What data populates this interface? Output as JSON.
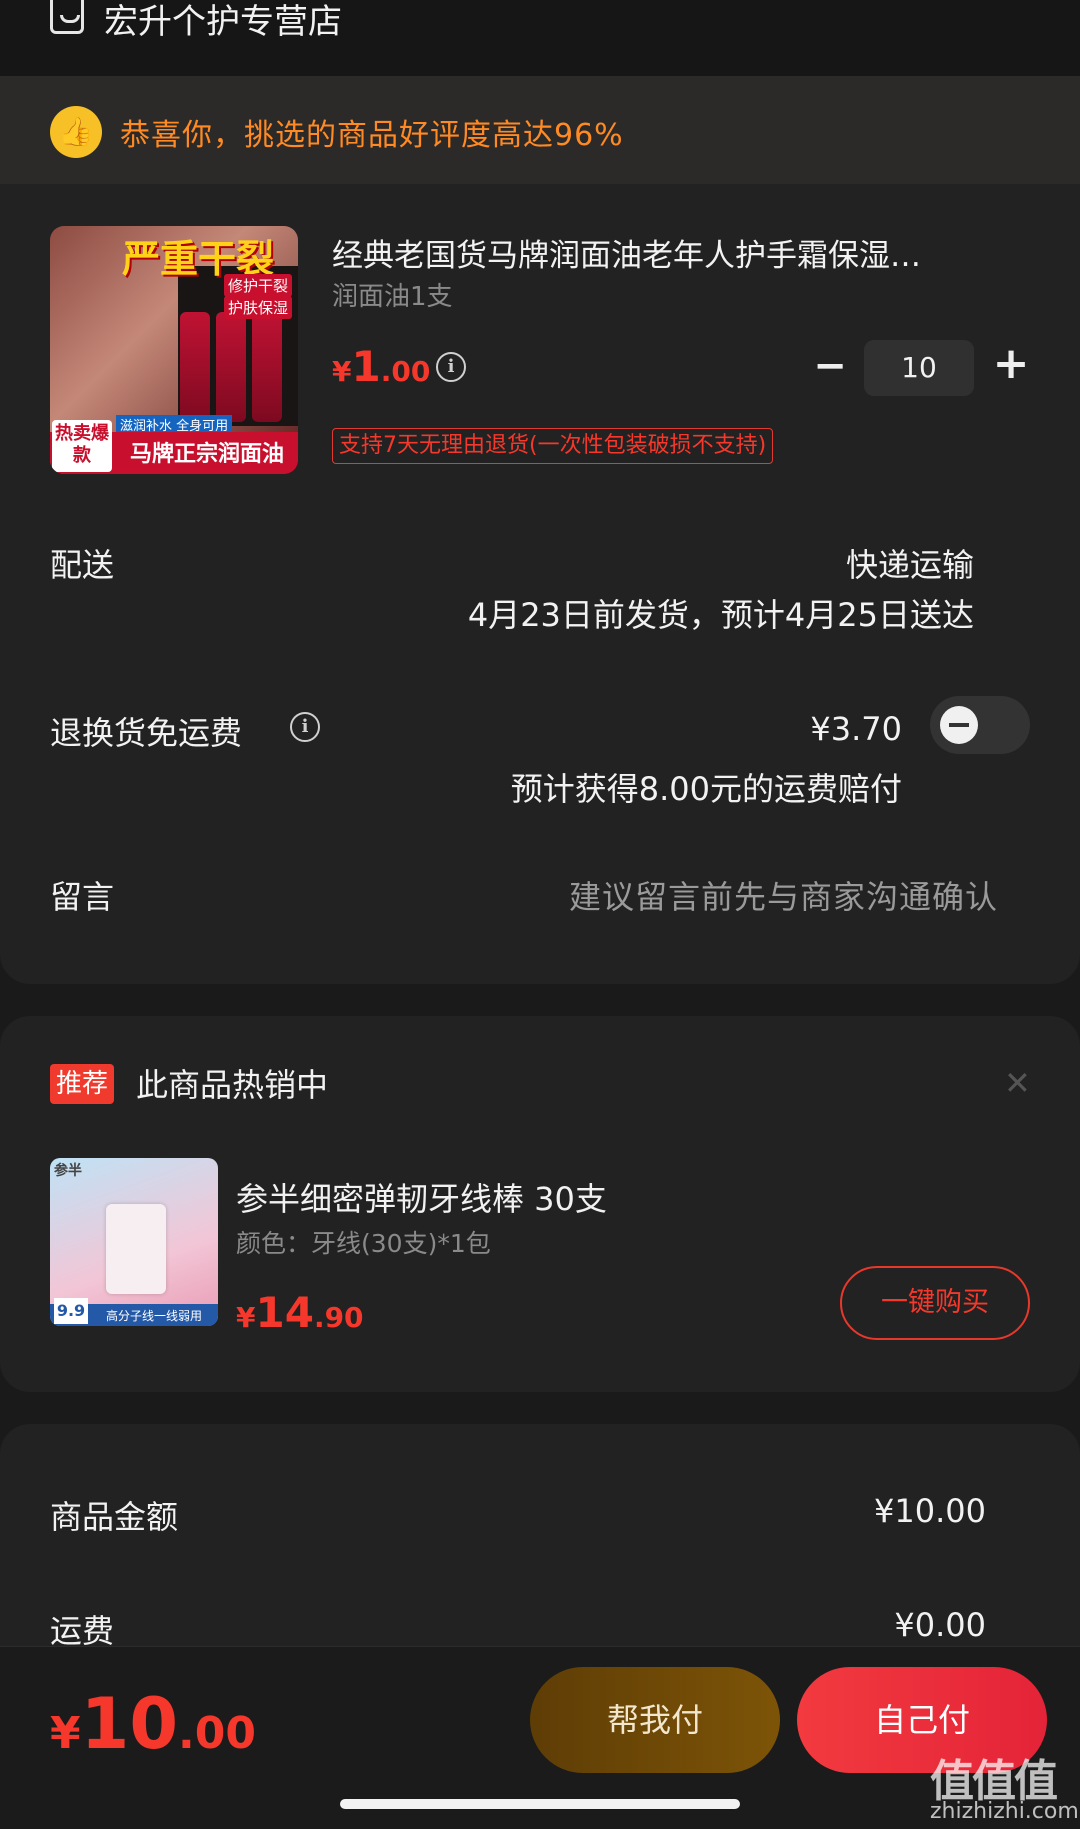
{
  "store": {
    "name": "宏升个护专营店",
    "icon": "store-icon"
  },
  "praise": {
    "text": "恭喜你，挑选的商品好评度高达96%",
    "icon": "thumbs-up-icon",
    "color": "#ff8a24"
  },
  "product": {
    "image": {
      "headline": "严重干裂",
      "tag1": "修护干裂",
      "tag2": "护肤保湿",
      "badge": "滋润补水 全身可用",
      "hot": "热卖爆款",
      "footer": "马牌正宗润面油"
    },
    "title": "经典老国货马牌润面油老年人护手霜保湿…",
    "spec": "润面油1支",
    "price": {
      "currency": "¥",
      "integer": "1",
      "decimal": ".00"
    },
    "quantity": "10",
    "minus_label": "−",
    "plus_label": "+",
    "return_policy": "支持7天无理由退货(一次性包装破损不支持)"
  },
  "delivery": {
    "label": "配送",
    "method": "快递运输",
    "eta": "4月23日前发货，预计4月25日送达"
  },
  "return_shipping": {
    "label": "退换货免运费",
    "price": "¥3.70",
    "note": "预计获得8.00元的运费赔付",
    "toggle_on": false
  },
  "message": {
    "label": "留言",
    "placeholder": "建议留言前先与商家沟通确认"
  },
  "recommend": {
    "tag": "推荐",
    "title": "此商品热销中",
    "item": {
      "image": {
        "brand": "参半",
        "price_badge": "9.9",
        "footer": "高分子线一线弱用"
      },
      "name": "参半细密弹韧牙线棒 30支",
      "spec": "颜色：牙线(30支)*1包",
      "price": {
        "currency": "¥",
        "integer": "14",
        "decimal": ".90"
      },
      "buy_label": "一键购买"
    }
  },
  "summary": {
    "rows": [
      {
        "label": "商品金额",
        "value": "¥10.00"
      },
      {
        "label": "运费",
        "value": "¥0.00"
      }
    ]
  },
  "footer": {
    "total": {
      "currency": "¥",
      "integer": "10",
      "decimal": ".00"
    },
    "help_pay": "帮我付",
    "self_pay": "自己付"
  },
  "watermark": {
    "main": "值值值",
    "sub": "zhizhizhi.com"
  },
  "colors": {
    "accent_red": "#f5382b",
    "bg": "#1a1a1a",
    "card": "#222222"
  }
}
